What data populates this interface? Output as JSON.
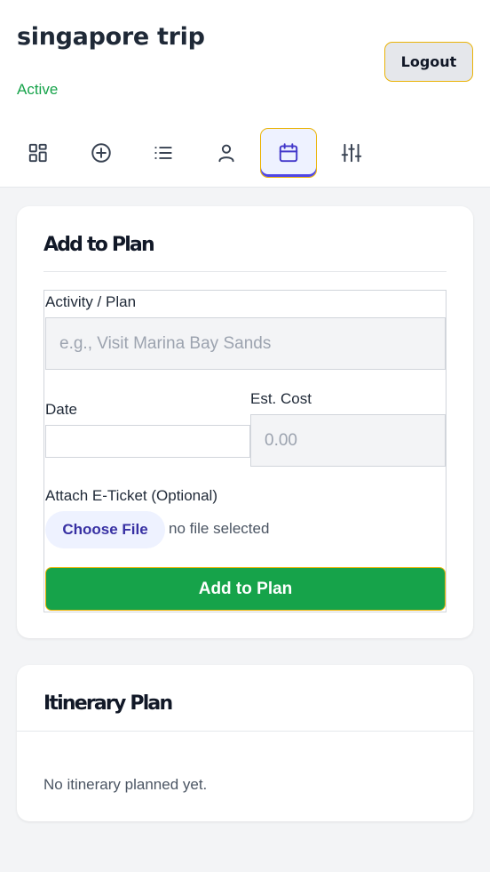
{
  "header": {
    "trip_title": "singapore trip",
    "status": "Active",
    "logout_label": "Logout"
  },
  "tabs": [
    {
      "icon": "dashboard-grid-icon",
      "active": false
    },
    {
      "icon": "add-circle-icon",
      "active": false
    },
    {
      "icon": "list-icon",
      "active": false
    },
    {
      "icon": "user-icon",
      "active": false
    },
    {
      "icon": "calendar-icon",
      "active": true
    },
    {
      "icon": "sliders-icon",
      "active": false
    }
  ],
  "add_plan": {
    "title": "Add to Plan",
    "activity_label": "Activity / Plan",
    "activity_placeholder": "e.g., Visit Marina Bay Sands",
    "date_label": "Date",
    "date_value": "",
    "cost_label": "Est. Cost",
    "cost_placeholder": "0.00",
    "attach_label": "Attach E-Ticket (Optional)",
    "choose_file_label": "Choose File",
    "file_status": "no file selected",
    "submit_label": "Add to Plan"
  },
  "itinerary": {
    "title": "Itinerary Plan",
    "empty_text": "No itinerary planned yet."
  },
  "colors": {
    "accent_green": "#16a34a",
    "active_outline": "#eab308",
    "indigo": "#4f46e5"
  }
}
